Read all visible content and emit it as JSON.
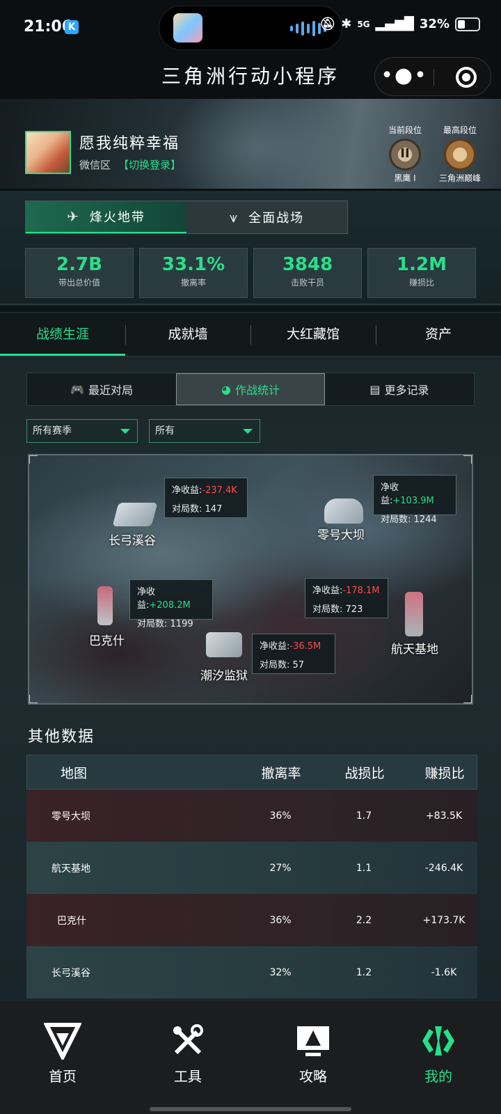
{
  "status_bar": {
    "time": "21:06",
    "app_badge": "K",
    "network": "5G",
    "battery": "32%",
    "icons": [
      "mute-icon",
      "bluetooth-icon",
      "signal-icon",
      "battery-icon"
    ]
  },
  "header": {
    "title": "三角洲行动小程序",
    "more_glyph": "•●•"
  },
  "profile": {
    "nickname": "愿我纯粹幸福",
    "zone": "微信区",
    "switch_login": "【切换登录】",
    "current_rank_label": "当前段位",
    "current_rank_name": "黑鹰 I",
    "current_rank_numeral": "II",
    "max_rank_label": "最高段位",
    "max_rank_name": "三角洲巅峰"
  },
  "mode_tabs": [
    {
      "label": "烽火地带",
      "icon": "helicopter-icon",
      "active": true
    },
    {
      "label": "全面战场",
      "icon": "wing-icon",
      "active": false
    }
  ],
  "stats": [
    {
      "value": "2.7B",
      "label": "带出总价值"
    },
    {
      "value": "33.1%",
      "label": "撤离率"
    },
    {
      "value": "3848",
      "label": "击败干员"
    },
    {
      "value": "1.2M",
      "label": "赚损比"
    }
  ],
  "section_tabs": [
    {
      "label": "战绩生涯",
      "active": true
    },
    {
      "label": "成就墙",
      "active": false
    },
    {
      "label": "大红藏馆",
      "active": false
    },
    {
      "label": "资产",
      "active": false
    }
  ],
  "sub_tabs": [
    {
      "label": "最近对局",
      "icon": "gamepad-icon",
      "glyph": "🎮",
      "active": false
    },
    {
      "label": "作战统计",
      "icon": "pie-chart-icon",
      "glyph": "◕",
      "active": true
    },
    {
      "label": "更多记录",
      "icon": "document-icon",
      "glyph": "▤",
      "active": false
    }
  ],
  "filters": {
    "season": "所有赛季",
    "scope": "所有"
  },
  "map_points": [
    {
      "name": "长弓溪谷",
      "profit_label": "净收益:",
      "profit": "-237.4K",
      "games_label": "对局数:",
      "games": "147"
    },
    {
      "name": "零号大坝",
      "profit_label": "净收益:",
      "profit": "+103.9M",
      "games_label": "对局数:",
      "games": "1244"
    },
    {
      "name": "巴克什",
      "profit_label": "净收益:",
      "profit": "+208.2M",
      "games_label": "对局数:",
      "games": "1199"
    },
    {
      "name": "航天基地",
      "profit_label": "净收益:",
      "profit": "-178.1M",
      "games_label": "对局数:",
      "games": "723"
    },
    {
      "name": "潮汐监狱",
      "profit_label": "净收益:",
      "profit": "-36.5M",
      "games_label": "对局数:",
      "games": "57"
    }
  ],
  "other_data": {
    "title": "其他数据",
    "headers": {
      "map": "地图",
      "rate": "撤离率",
      "kd": "战损比",
      "profit": "赚损比"
    },
    "rows": [
      {
        "map": "零号大坝",
        "rate": "36%",
        "kd": "1.7",
        "profit": "+83.5K"
      },
      {
        "map": "航天基地",
        "rate": "27%",
        "kd": "1.1",
        "profit": "-246.4K"
      },
      {
        "map": "巴克什",
        "rate": "36%",
        "kd": "2.2",
        "profit": "+173.7K"
      },
      {
        "map": "长弓溪谷",
        "rate": "32%",
        "kd": "1.2",
        "profit": "-1.6K"
      }
    ]
  },
  "bottom_nav": [
    {
      "label": "首页",
      "icon": "home-logo-icon",
      "active": false
    },
    {
      "label": "工具",
      "icon": "tools-icon",
      "active": false
    },
    {
      "label": "攻略",
      "icon": "guide-icon",
      "active": false
    },
    {
      "label": "我的",
      "icon": "profile-logo-icon",
      "active": true
    }
  ],
  "colors": {
    "accent": "#27e08a",
    "negative": "#ff4a4a",
    "background": "#0d1416"
  }
}
